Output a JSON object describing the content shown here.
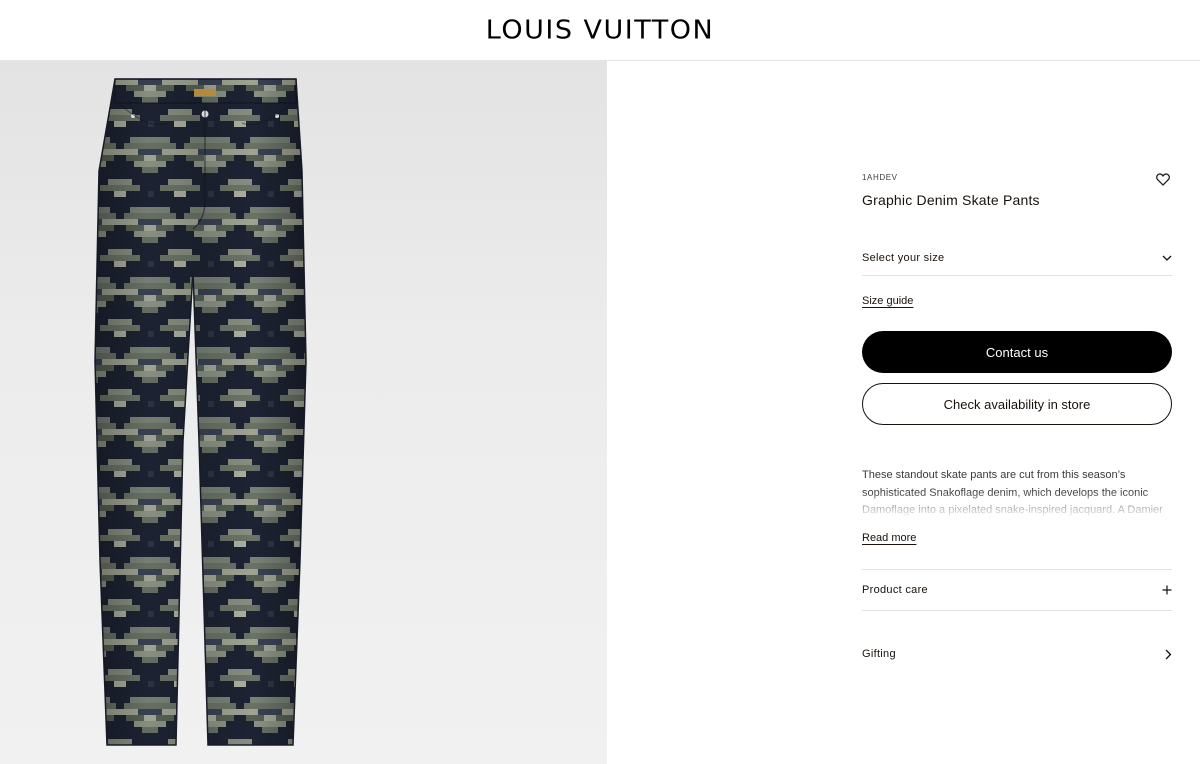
{
  "header": {
    "brand": "LOUIS VUITTON"
  },
  "product": {
    "sku": "1AHDEV",
    "name": "Graphic Denim Skate Pants",
    "size_select_label": "Select your size",
    "size_guide_label": "Size guide",
    "contact_label": "Contact us",
    "availability_label": "Check availability in store",
    "description": "These standout skate pants are cut from this season’s sophisticated Snakoflage denim, which develops the iconic Damoflage into a pixelated snake-inspired jacquard. A Damier",
    "read_more_label": "Read more",
    "care_label": "Product care",
    "gifting_label": "Gifting"
  },
  "icons": {
    "wishlist": "heart-icon",
    "size_dropdown": "chevron-down-icon",
    "care_expand": "plus-icon",
    "gifting_next": "chevron-right-icon"
  },
  "colors": {
    "primary_button": "#000000",
    "text": "#19110b",
    "image_background": "#ececec",
    "denim_dark": "#1d2333",
    "denim_light": "#8e9288"
  }
}
